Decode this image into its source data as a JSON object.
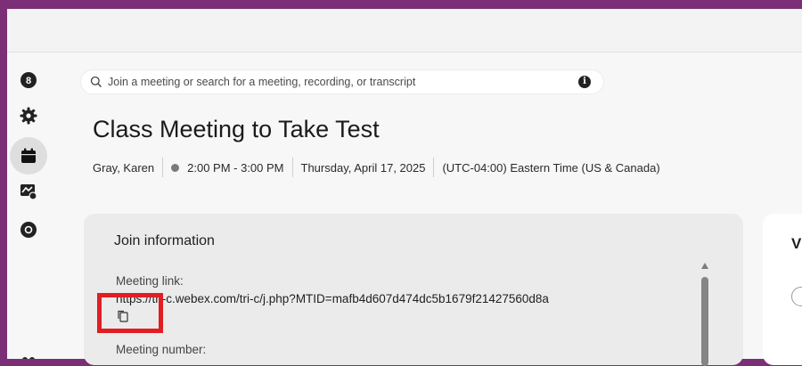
{
  "search": {
    "placeholder": "Join a meeting or search for a meeting, recording, or transcript"
  },
  "meeting": {
    "title": "Class Meeting to Take Test",
    "host": "Gray, Karen",
    "time": "2:00 PM - 3:00 PM",
    "date": "Thursday, April 17, 2025",
    "timezone": "(UTC-04:00) Eastern Time (US & Canada)"
  },
  "join_info": {
    "heading": "Join information",
    "link_label": "Meeting link:",
    "link_value": "https://tri-c.webex.com/tri-c/j.php?MTID=mafb4d607d474dc5b1679f21427560d8a",
    "number_label": "Meeting number:"
  },
  "side_card": {
    "heading_initial": "V"
  },
  "colors": {
    "frame": "#7a2f77",
    "highlight": "#e01e23",
    "card": "#ebebeb"
  },
  "icons": [
    "contacts-icon",
    "gear-icon",
    "calendar-icon",
    "whiteboard-icon",
    "record-icon",
    "search-icon",
    "info-icon",
    "copy-icon"
  ]
}
